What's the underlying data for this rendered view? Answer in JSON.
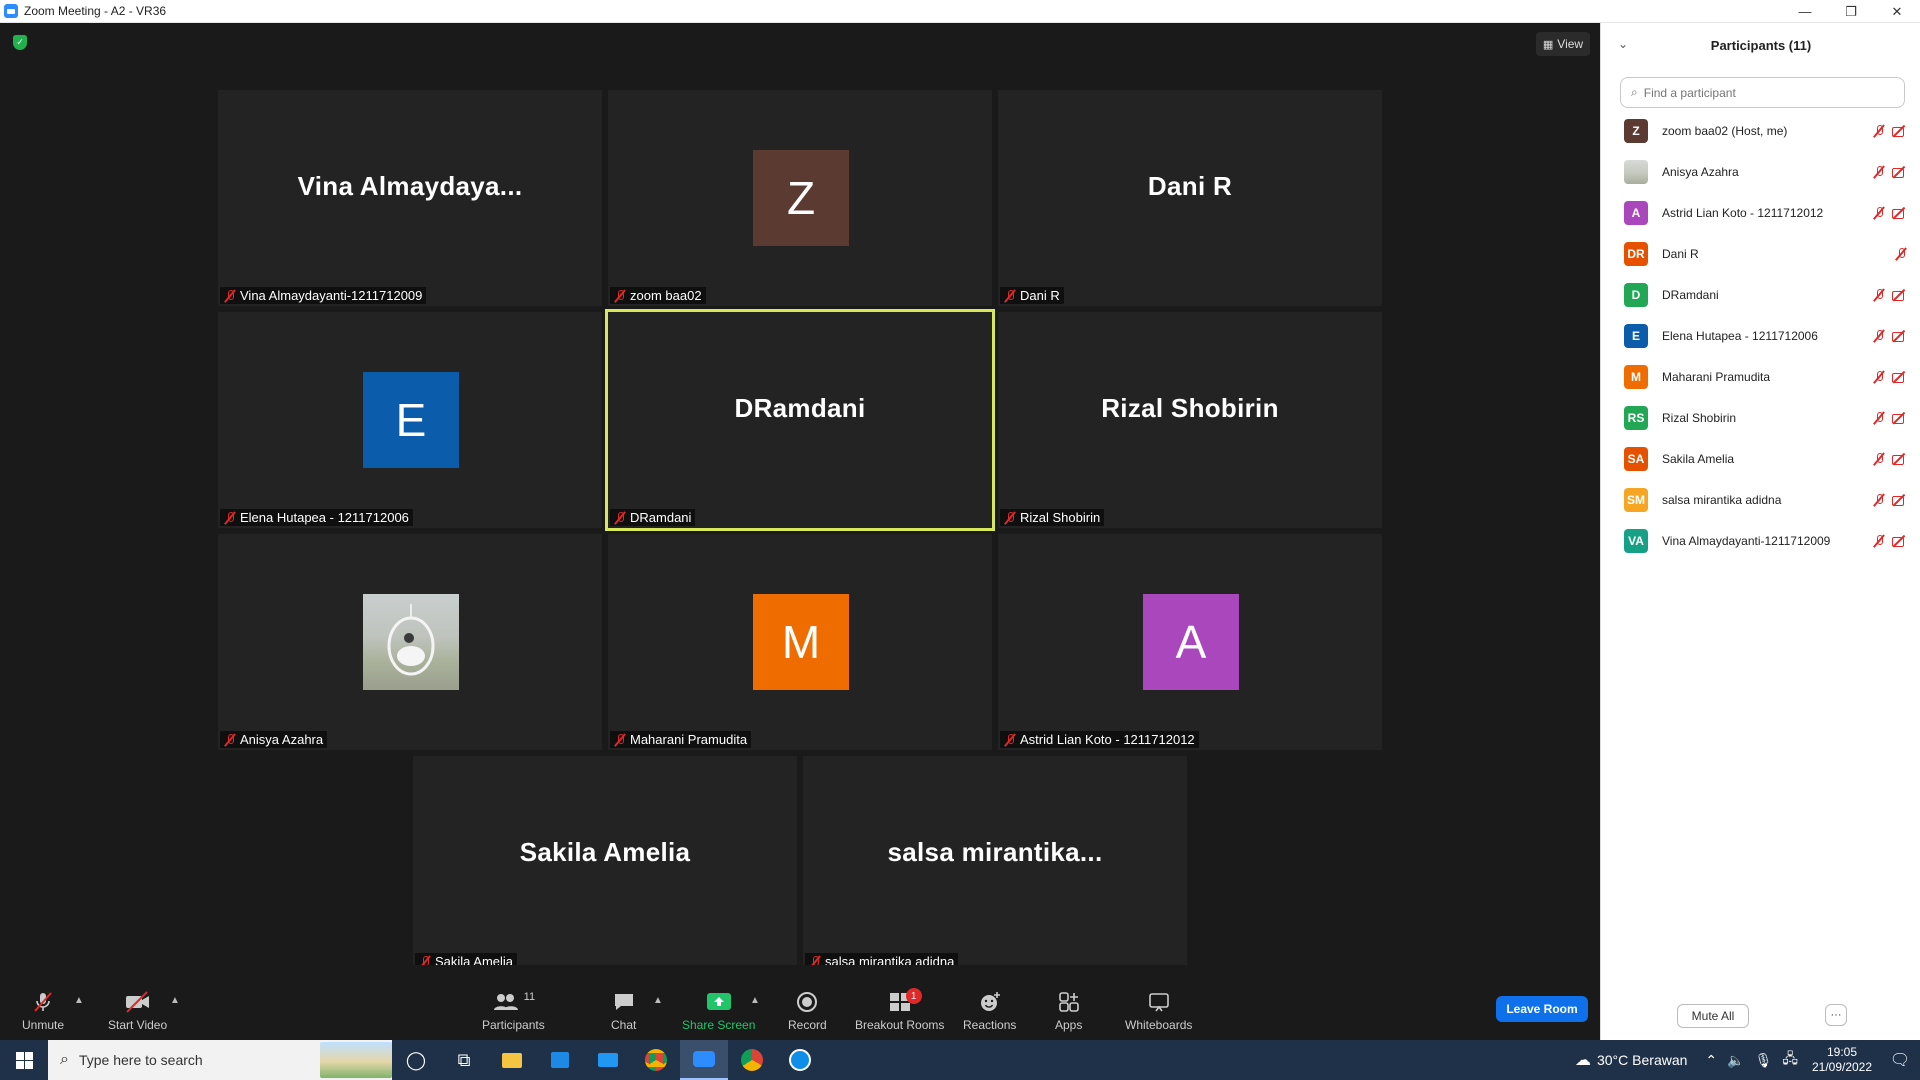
{
  "window": {
    "title": "Zoom Meeting - A2 - VR36",
    "min_glyph": "—",
    "max_glyph": "❐",
    "close_glyph": "✕"
  },
  "meeting": {
    "view_label": "View",
    "tiles": [
      {
        "display": "Vina  Almaydaya...",
        "label": "Vina Almaydayanti-1211712009",
        "avatar": null
      },
      {
        "display": "",
        "label": "zoom baa02",
        "avatar": {
          "letter": "Z",
          "color": "#5b3a31"
        }
      },
      {
        "display": "Dani R",
        "label": "Dani R",
        "avatar": null
      },
      {
        "display": "",
        "label": "Elena Hutapea - 1211712006",
        "avatar": {
          "letter": "E",
          "color": "#0b5cab"
        }
      },
      {
        "display": "DRamdani",
        "label": "DRamdani",
        "avatar": null,
        "speaking": true
      },
      {
        "display": "Rizal Shobirin",
        "label": "Rizal Shobirin",
        "avatar": null
      },
      {
        "display": "",
        "label": "Anisya Azahra",
        "avatar": {
          "letter": "",
          "color": "photo"
        }
      },
      {
        "display": "",
        "label": "Maharani Pramudita",
        "avatar": {
          "letter": "M",
          "color": "#ef6c00"
        }
      },
      {
        "display": "",
        "label": "Astrid Lian Koto - 1211712012",
        "avatar": {
          "letter": "A",
          "color": "#ab47bc"
        }
      },
      {
        "display": "Sakila Amelia",
        "label": "Sakila Amelia",
        "avatar": null
      },
      {
        "display": "salsa  mirantika...",
        "label": "salsa mirantika adidna",
        "avatar": null
      }
    ]
  },
  "toolbar": {
    "unmute": "Unmute",
    "start_video": "Start Video",
    "participants": "Participants",
    "participants_count": "11",
    "chat": "Chat",
    "share_screen": "Share Screen",
    "record": "Record",
    "breakout_rooms": "Breakout Rooms",
    "breakout_badge": "1",
    "reactions": "Reactions",
    "apps": "Apps",
    "whiteboards": "Whiteboards",
    "leave": "Leave Room"
  },
  "panel": {
    "title": "Participants (11)",
    "search_placeholder": "Find a participant",
    "participants": [
      {
        "name": "zoom baa02 (Host, me)",
        "initials": "Z",
        "color": "#5b3a31",
        "video_off": true
      },
      {
        "name": "Anisya Azahra",
        "initials": "",
        "color": "photo",
        "video_off": true
      },
      {
        "name": "Astrid Lian Koto - 1211712012",
        "initials": "A",
        "color": "#ab47bc",
        "video_off": true
      },
      {
        "name": "Dani R",
        "initials": "DR",
        "color": "#e65100",
        "video_off": false
      },
      {
        "name": "DRamdani",
        "initials": "D",
        "color": "#22a855",
        "video_off": true
      },
      {
        "name": "Elena Hutapea - 1211712006",
        "initials": "E",
        "color": "#0b5cab",
        "video_off": true
      },
      {
        "name": "Maharani Pramudita",
        "initials": "M",
        "color": "#ef6c00",
        "video_off": true
      },
      {
        "name": "Rizal Shobirin",
        "initials": "RS",
        "color": "#22a855",
        "video_off": true
      },
      {
        "name": "Sakila Amelia",
        "initials": "SA",
        "color": "#e65100",
        "video_off": true
      },
      {
        "name": "salsa mirantika adidna",
        "initials": "SM",
        "color": "#f6a623",
        "video_off": true
      },
      {
        "name": "Vina Almaydayanti-1211712009",
        "initials": "VA",
        "color": "#16a085",
        "video_off": true
      }
    ],
    "mute_all": "Mute All",
    "more": "···"
  },
  "taskbar": {
    "search_placeholder": "Type here to search",
    "weather": "30°C  Berawan",
    "time": "19:05",
    "date": "21/09/2022"
  }
}
